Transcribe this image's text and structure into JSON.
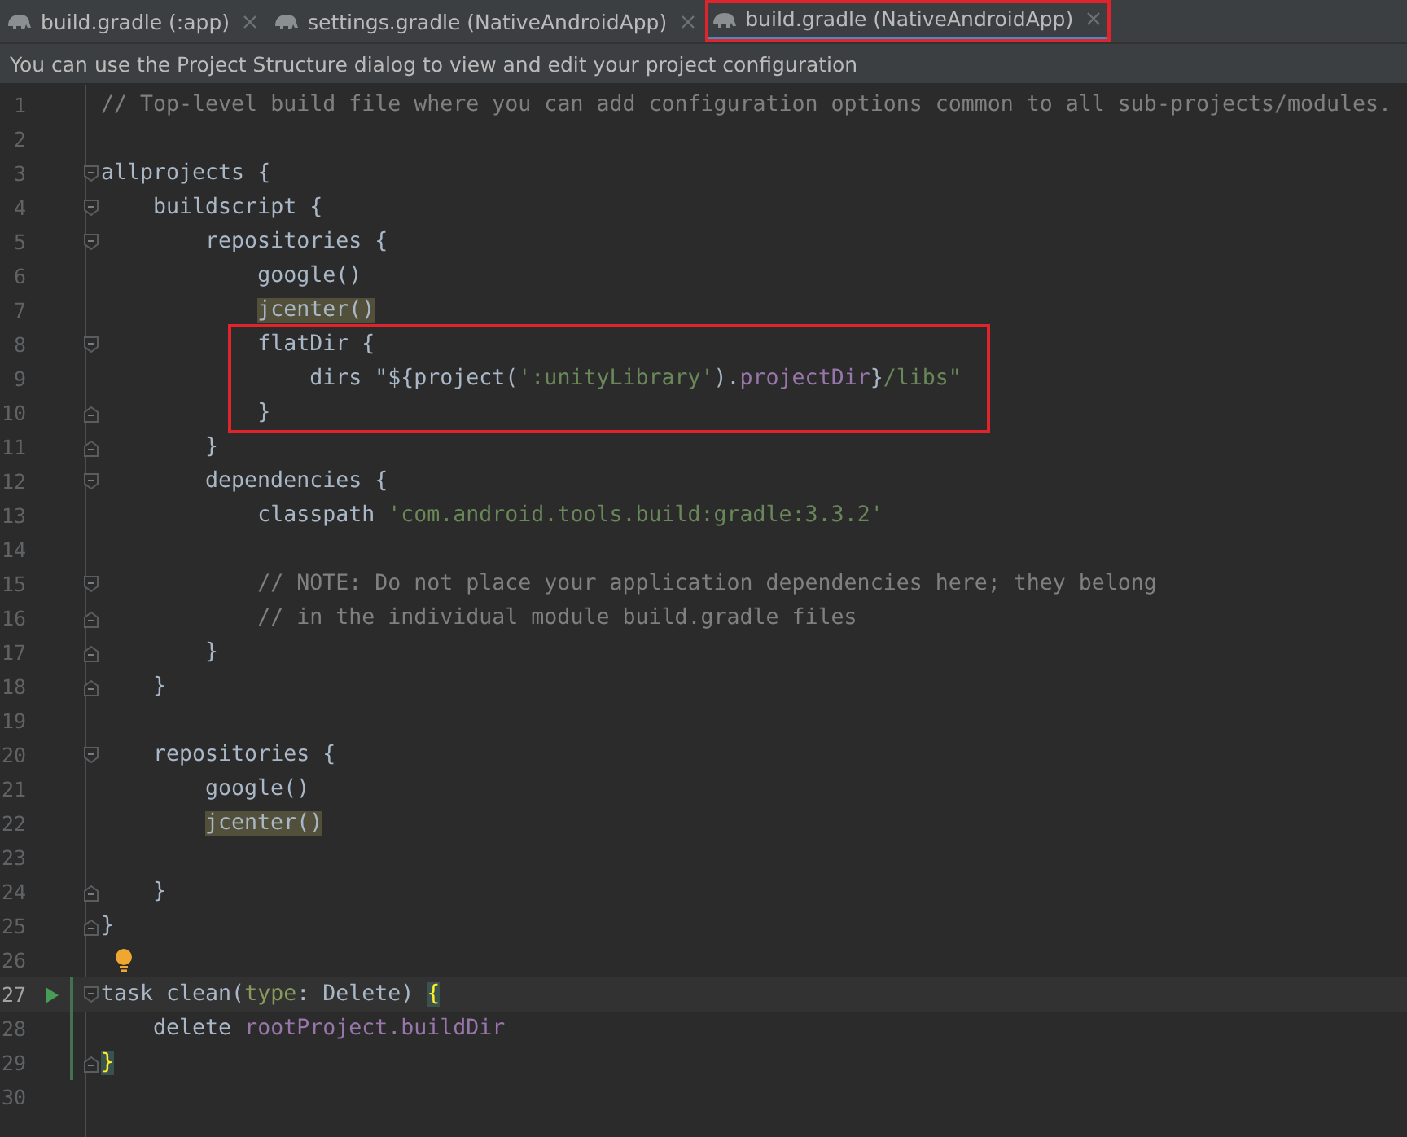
{
  "tabs": [
    {
      "label": "build.gradle (:app)",
      "selected": false,
      "annotated": false
    },
    {
      "label": "settings.gradle (NativeAndroidApp)",
      "selected": false,
      "annotated": false
    },
    {
      "label": "build.gradle (NativeAndroidApp)",
      "selected": true,
      "annotated": true
    }
  ],
  "notification": "You can use the Project Structure dialog to view and edit your project configuration",
  "lines": [
    {
      "number": "1",
      "tokens": [
        {
          "text": "// Top-level build file where you can add configuration options common to all sub-projects/modules.",
          "kind": "comment"
        }
      ]
    },
    {
      "number": "2"
    },
    {
      "number": "3",
      "fold_start": true,
      "tokens": [
        {
          "text": "allprojects {",
          "kind": "code"
        }
      ]
    },
    {
      "number": "4",
      "fold_start": true,
      "tokens": [
        {
          "text": "    buildscript {",
          "kind": "code"
        }
      ]
    },
    {
      "number": "5",
      "fold_start": true,
      "tokens": [
        {
          "text": "        repositories {",
          "kind": "code"
        }
      ]
    },
    {
      "number": "6",
      "tokens": [
        {
          "text": "            google()",
          "kind": "code"
        }
      ]
    },
    {
      "number": "7",
      "tokens": [
        {
          "text": "            jcenter()",
          "kind": "highlight"
        }
      ]
    },
    {
      "number": "8",
      "fold_start": true,
      "annotated": true,
      "tokens": [
        {
          "text": "            flatDir {",
          "kind": "code"
        }
      ]
    },
    {
      "number": "9",
      "annotated": true,
      "tokens": [
        {
          "text": "                dirs \"${",
          "kind": "code"
        },
        {
          "text": "project(",
          "kind": "code"
        },
        {
          "text": "':unityLibrary'",
          "kind": "string"
        },
        {
          "text": ").",
          "kind": "code"
        },
        {
          "text": "projectDir",
          "kind": "property"
        },
        {
          "text": "}",
          "kind": "code"
        },
        {
          "text": "/libs\"",
          "kind": "string"
        }
      ]
    },
    {
      "number": "10",
      "fold_end": true,
      "annotated": true,
      "tokens": [
        {
          "text": "            }",
          "kind": "code"
        }
      ]
    },
    {
      "number": "11",
      "fold_end": true,
      "tokens": [
        {
          "text": "        }",
          "kind": "code"
        }
      ]
    },
    {
      "number": "12",
      "fold_start": true,
      "tokens": [
        {
          "text": "        dependencies {",
          "kind": "code"
        }
      ]
    },
    {
      "number": "13",
      "tokens": [
        {
          "text": "            classpath ",
          "kind": "code"
        },
        {
          "text": "'com.android.tools.build:gradle:3.3.2'",
          "kind": "string"
        }
      ]
    },
    {
      "number": "14"
    },
    {
      "number": "15",
      "fold_start": true,
      "tokens": [
        {
          "text": "            // NOTE: Do not place your application dependencies here; they belong",
          "kind": "comment"
        }
      ]
    },
    {
      "number": "16",
      "fold_end": true,
      "tokens": [
        {
          "text": "            // in the individual module build.gradle files",
          "kind": "comment"
        }
      ]
    },
    {
      "number": "17",
      "fold_end": true,
      "tokens": [
        {
          "text": "        }",
          "kind": "code"
        }
      ]
    },
    {
      "number": "18",
      "fold_end": true,
      "tokens": [
        {
          "text": "    }",
          "kind": "code"
        }
      ]
    },
    {
      "number": "19"
    },
    {
      "number": "20",
      "fold_start": true,
      "tokens": [
        {
          "text": "    repositories {",
          "kind": "code"
        }
      ]
    },
    {
      "number": "21",
      "tokens": [
        {
          "text": "        google()",
          "kind": "code"
        }
      ]
    },
    {
      "number": "22",
      "tokens": [
        {
          "text": "        jcenter()",
          "kind": "highlight"
        }
      ]
    },
    {
      "number": "23"
    },
    {
      "number": "24",
      "fold_end": true,
      "tokens": [
        {
          "text": "    }",
          "kind": "code"
        }
      ]
    },
    {
      "number": "25",
      "fold_end": true,
      "tokens": [
        {
          "text": "}",
          "kind": "code"
        }
      ]
    },
    {
      "number": "26",
      "bulb": true
    },
    {
      "number": "27",
      "fold_start": true,
      "current": true,
      "run": true,
      "changed": true,
      "tokens": [
        {
          "text": "task clean(",
          "kind": "code"
        },
        {
          "text": "type",
          "kind": "param"
        },
        {
          "text": ": Delete) ",
          "kind": "code"
        },
        {
          "text": "{",
          "kind": "match"
        }
      ]
    },
    {
      "number": "28",
      "changed": true,
      "tokens": [
        {
          "text": "    delete ",
          "kind": "code"
        },
        {
          "text": "rootProject.buildDir",
          "kind": "property"
        }
      ]
    },
    {
      "number": "29",
      "fold_end": true,
      "changed": true,
      "tokens": [
        {
          "text": "}",
          "kind": "match"
        }
      ]
    },
    {
      "number": "30"
    }
  ]
}
